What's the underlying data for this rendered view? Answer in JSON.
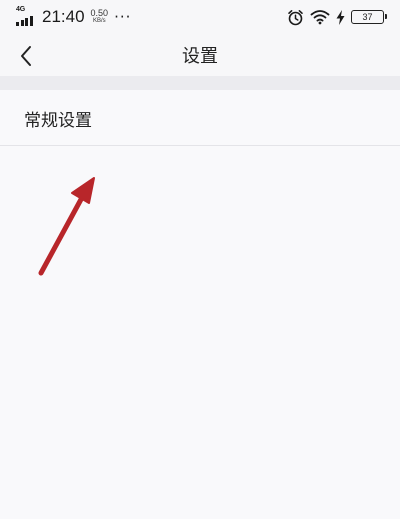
{
  "status_bar": {
    "network": "4G",
    "time": "21:40",
    "speed_value": "0.50",
    "speed_unit": "KB/s",
    "more": "···",
    "battery": "37",
    "icons": [
      "signal-icon",
      "alarm-icon",
      "wifi-icon",
      "charging-icon",
      "battery-icon"
    ]
  },
  "nav": {
    "back_icon": "chevron-left-icon",
    "title": "设置"
  },
  "settings": {
    "items": [
      {
        "label": "常规设置"
      }
    ]
  },
  "annotation": {
    "arrow_icon": "red-arrow-icon",
    "color": "#c0282a"
  }
}
